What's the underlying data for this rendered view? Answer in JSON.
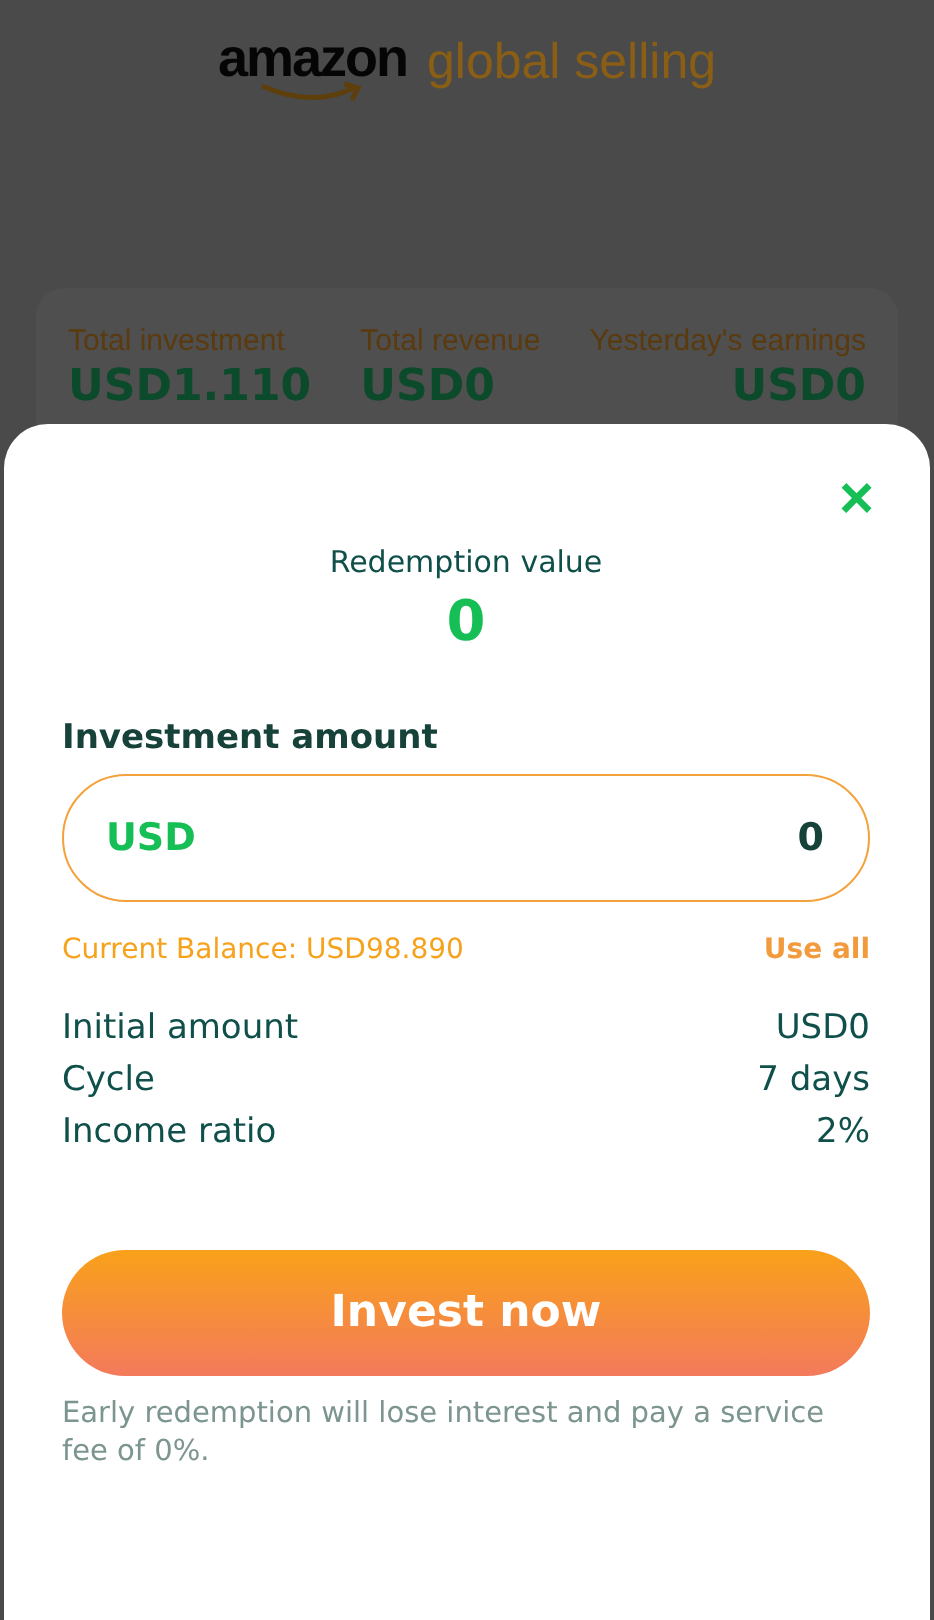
{
  "header": {
    "logo_word": "amazon",
    "logo_tagline": "global selling"
  },
  "stats": [
    {
      "label": "Total investment",
      "value": "USD1.110"
    },
    {
      "label": "Total revenue",
      "value": "USD0"
    },
    {
      "label": "Yesterday's earnings",
      "value": "USD0"
    }
  ],
  "dialog": {
    "close": "×",
    "redemption_label": "Redemption value",
    "redemption_value": "0",
    "amount_label": "Investment amount",
    "currency": "USD",
    "amount_value": "0",
    "balance": "Current Balance: USD98.890",
    "use_all": "Use all",
    "details": [
      {
        "label": "Initial amount",
        "value": "USD0"
      },
      {
        "label": "Cycle",
        "value": "7 days"
      },
      {
        "label": "Income ratio",
        "value": "2%"
      }
    ],
    "button": "Invest now",
    "note": "Early redemption will lose interest and pay a service fee of 0%."
  }
}
